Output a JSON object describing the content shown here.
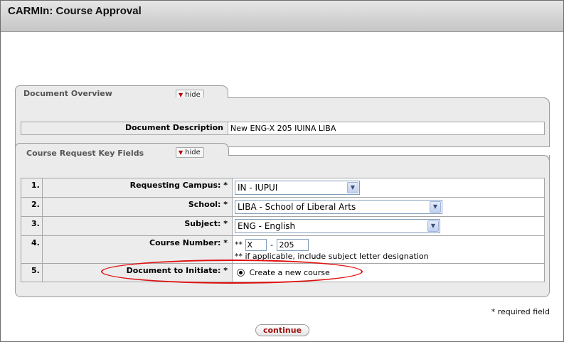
{
  "header": {
    "title": "CARMIn: Course Approval"
  },
  "document_overview": {
    "tab_title": "Document Overview",
    "hide_label": "hide",
    "description_label": "Document Description",
    "description_value": "New ENG-X 205 IUINA LIBA"
  },
  "key_fields": {
    "tab_title": "Course Request Key Fields",
    "hide_label": "hide",
    "rows": [
      {
        "num": "1.",
        "label": "Requesting Campus: *",
        "value": "IN - IUPUI"
      },
      {
        "num": "2.",
        "label": "School: *",
        "value": "LIBA - School of Liberal Arts"
      },
      {
        "num": "3.",
        "label": "Subject: *",
        "value": "ENG - English"
      },
      {
        "num": "4.",
        "label": "Course Number: *",
        "prefix": "**",
        "letter": "X",
        "dash": "-",
        "number": "205",
        "hint": "** if applicable, include subject letter designation"
      },
      {
        "num": "5.",
        "label": "Document to Initiate: *",
        "value": "Create a new course"
      }
    ]
  },
  "footer": {
    "required_note": "* required field",
    "continue_label": "continue"
  },
  "colors": {
    "highlight": "#e01010",
    "button_text": "#a11010"
  }
}
